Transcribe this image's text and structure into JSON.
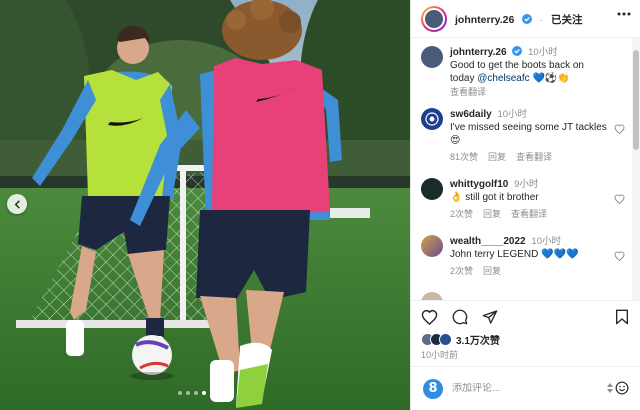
{
  "header": {
    "username": "johnterry.26",
    "follow_label": "已关注"
  },
  "post": {
    "username": "johnterry.26",
    "time": "10小时",
    "caption_text": "Good to get the boots back on today ",
    "caption_mention": "@chelseafc",
    "caption_emoji": "💙⚽👏",
    "see_translation": "查看翻译"
  },
  "comments": [
    {
      "username": "sw6daily",
      "time": "10小时",
      "text": "I've missed seeing some JT tackles 😍",
      "likes": "81次赞",
      "reply": "回复",
      "translate": "查看翻译"
    },
    {
      "username": "whittygolf10",
      "time": "9小时",
      "text": "👌 still got it brother",
      "likes": "2次赞",
      "reply": "回复",
      "translate": "查看翻译"
    },
    {
      "username": "wealth____2022",
      "time": "10小时",
      "text": "John terry LEGEND 💙💙💙",
      "likes": "2次赞",
      "reply": "回复",
      "translate": ""
    }
  ],
  "actions": {
    "likes_count": "3.1万次赞",
    "post_age": "10小时前"
  },
  "comment_box": {
    "placeholder": "添加评论..."
  },
  "icons": {
    "prev": "chevron-left-icon",
    "heart": "heart-icon",
    "comment": "comment-icon",
    "share": "send-icon",
    "bookmark": "bookmark-icon",
    "emoji": "smiley-icon",
    "more": "more-icon"
  },
  "colors": {
    "verified": "#3897f0",
    "link": "#00376b",
    "muted": "#8e8e8e",
    "bib_yellow": "#b6e03a",
    "bib_pink": "#e8417a"
  }
}
